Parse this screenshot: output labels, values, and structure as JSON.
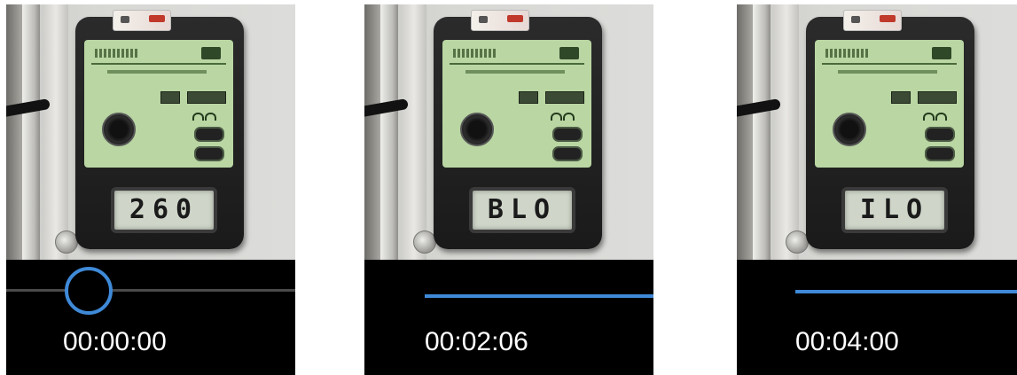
{
  "frames": [
    {
      "display": "260",
      "timestamp": "00:00:00",
      "progress": 0.0
    },
    {
      "display": "BLO",
      "timestamp": "00:02:06",
      "progress": 0.52
    },
    {
      "display": "ILO",
      "timestamp": "00:04:00",
      "progress": 1.0
    }
  ],
  "colors": {
    "accent": "#3f8ad8",
    "player_bg": "#000000",
    "lcd": "#cfd6c9",
    "panel": "#b9d6a3"
  },
  "icons": [
    "scrubber-thumb-icon"
  ]
}
